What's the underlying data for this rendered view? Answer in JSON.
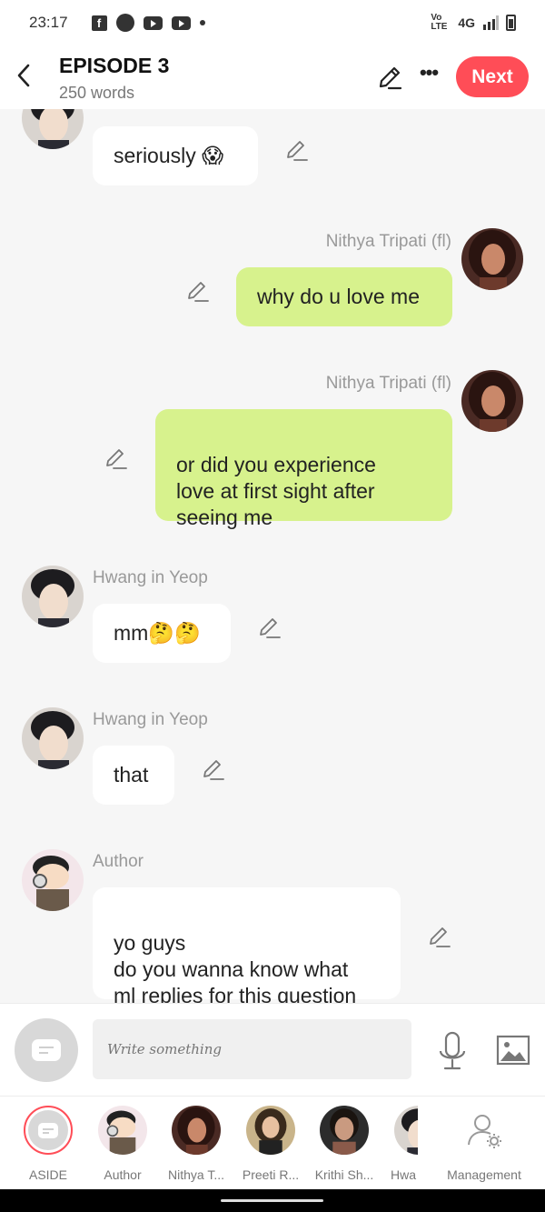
{
  "status_bar": {
    "time": "23:17",
    "network": "4G",
    "volte": "Vo LTE"
  },
  "header": {
    "title": "EPISODE 3",
    "subtitle": "250 words",
    "next_label": "Next"
  },
  "messages": [
    {
      "sender": "",
      "text": "seriously 😱",
      "side": "left"
    },
    {
      "sender": "Nithya Tripati (fl)",
      "text": "why do u love me",
      "side": "right"
    },
    {
      "sender": "Nithya Tripati (fl)",
      "text": "or did you experience\nlove at first sight after\nseeing me",
      "side": "right"
    },
    {
      "sender": "Hwang in Yeop",
      "text": "mm🤔🤔",
      "side": "left"
    },
    {
      "sender": "Hwang in Yeop",
      "text": "that",
      "side": "left"
    },
    {
      "sender": "Author",
      "text": "yo guys\ndo you wanna know what\nml replies for this question",
      "side": "left"
    }
  ],
  "composer": {
    "placeholder": "Write something"
  },
  "characters": [
    {
      "name": "ASIDE"
    },
    {
      "name": "Author"
    },
    {
      "name": "Nithya T..."
    },
    {
      "name": "Preeti R..."
    },
    {
      "name": "Krithi Sh..."
    },
    {
      "name": "Hwa"
    }
  ],
  "management_label": "Management",
  "colors": {
    "accent": "#ff4d57",
    "right_bubble": "#d7f28d",
    "left_bubble": "#ffffff"
  },
  "icons": [
    "back-arrow-icon",
    "pencil-icon",
    "more-icon",
    "microphone-icon",
    "image-icon",
    "note-icon",
    "user-settings-icon"
  ]
}
